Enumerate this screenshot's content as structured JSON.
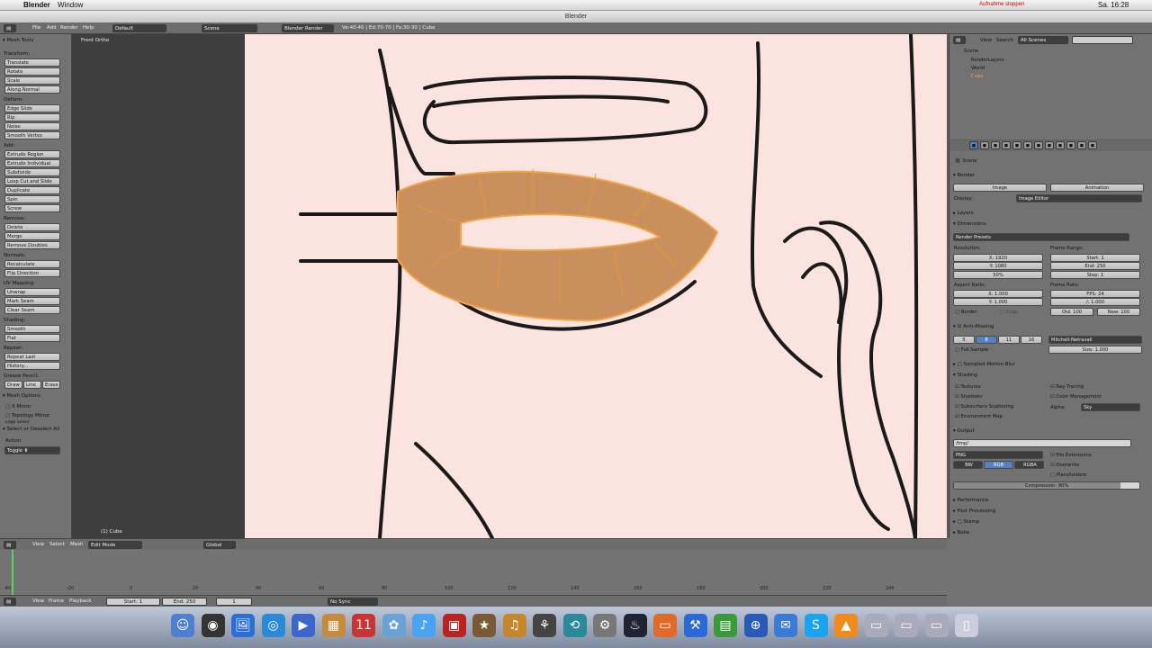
{
  "mac": {
    "app_name": "Blender",
    "window_menu": "Window",
    "status_text": "Aufnahme stoppen",
    "clock": "Sa. 16:28"
  },
  "window_title": "Blender",
  "info_header": {
    "menus": [
      "File",
      "Add",
      "Render",
      "Help"
    ],
    "layout": "Default",
    "scene": "Scene",
    "engine": "Blender Render",
    "stats": "Ve:40-40 | Ed:70-70 | Fa:30-30 | Cube"
  },
  "tool_shelf": {
    "title": "Mesh Tools",
    "sections": [
      {
        "label": "Transform:",
        "buttons": [
          "Translate",
          "Rotate",
          "Scale",
          "Along Normal"
        ]
      },
      {
        "label": "Deform:",
        "buttons": [
          "Edge Slide",
          "Rip",
          "Noise",
          "Smooth Vertex"
        ]
      },
      {
        "label": "Add:",
        "buttons": [
          "Extrude Region",
          "Extrude Individual",
          "Subdivide",
          "Loop Cut and Slide",
          "Duplicate",
          "Spin",
          "Screw"
        ]
      },
      {
        "label": "Remove:",
        "buttons": [
          "Delete",
          "Merge",
          "Remove Doubles"
        ]
      },
      {
        "label": "Normals:",
        "buttons": [
          "Recalculate",
          "Flip Direction"
        ]
      },
      {
        "label": "UV Mapping:",
        "buttons": [
          "Unwrap",
          "Mark Seam",
          "Clear Seam"
        ]
      },
      {
        "label": "Shading:",
        "buttons": [
          "Smooth",
          "Flat"
        ]
      },
      {
        "label": "Repeat:",
        "buttons": [
          "Repeat Last",
          "History..."
        ]
      }
    ],
    "grease_pencil": {
      "label": "Grease Pencil:",
      "buttons": [
        "Draw",
        "Line",
        "Erase"
      ]
    },
    "mesh_options": {
      "title": "Mesh Options",
      "x_mirror": "X Mirror",
      "topology_mirror": "Topology Mirror",
      "edge_select": "Edge Select"
    },
    "operator": {
      "title": "Select or Deselect All",
      "action_label": "Action",
      "action_value": "Toggle"
    }
  },
  "viewport": {
    "view_label": "Front Ortho",
    "object_label": "(1) Cube"
  },
  "outliner": {
    "menus": [
      "View",
      "Search"
    ],
    "filter": "All Scenes",
    "items": [
      "Scene",
      "RenderLayers",
      "World",
      "Cube"
    ]
  },
  "properties": {
    "scene_label": "Scene",
    "render_panel": {
      "title": "Render",
      "image_button": "Image",
      "animation_button": "Animation",
      "display_label": "Display:",
      "display_value": "Image Editor"
    },
    "layers_title": "Layers",
    "dimensions": {
      "title": "Dimensions",
      "presets": "Render Presets",
      "resolution_label": "Resolution:",
      "res_x": "X: 1920",
      "res_y": "Y: 1080",
      "res_pct": "50%",
      "frame_range_label": "Frame Range:",
      "start": "Start: 1",
      "end": "End: 250",
      "step": "Step: 1",
      "aspect_label": "Aspect Ratio:",
      "aspect_x": "X: 1.000",
      "aspect_y": "Y: 1.000",
      "frame_rate_label": "Frame Rate:",
      "fps": "FPS: 24",
      "fps_base": "/: 1.000",
      "border": "Border",
      "crop": "Crop",
      "old": "Old: 100",
      "new": "New: 100"
    },
    "anti_aliasing": {
      "title": "Anti-Aliasing",
      "samples": [
        "5",
        "8",
        "11",
        "16"
      ],
      "selected": "8",
      "filter": "Mitchell-Netravali",
      "full_sample": "Full Sample",
      "size": "Size: 1.000"
    },
    "motion_blur": "Sampled Motion Blur",
    "shading": {
      "title": "Shading",
      "left": [
        "Textures",
        "Shadows",
        "Subsurface Scattering",
        "Environment Map"
      ],
      "right": [
        "Ray Tracing",
        "Color Management"
      ],
      "alpha_label": "Alpha:",
      "alpha_value": "Sky"
    },
    "output": {
      "title": "Output",
      "path": "/tmp/",
      "format": "PNG",
      "color_modes": [
        "BW",
        "RGB",
        "RGBA"
      ],
      "selected_mode": "RGB",
      "file_ext": "File Extensions",
      "overwrite": "Overwrite",
      "placeholders": "Placeholders",
      "compression": "Compression: 90%",
      "compression_value": 0.9
    },
    "collapsed": [
      "Performance",
      "Post Processing",
      "Stamp",
      "Bake"
    ]
  },
  "viewport_header": {
    "menus": [
      "View",
      "Select",
      "Mesh"
    ],
    "mode": "Edit Mode",
    "orientation": "Global"
  },
  "timeline": {
    "ticks": [
      "-40",
      "-20",
      "0",
      "20",
      "40",
      "60",
      "80",
      "100",
      "120",
      "140",
      "160",
      "180",
      "200",
      "220",
      "240"
    ],
    "menus": [
      "View",
      "Frame",
      "Playback"
    ],
    "start": "Start: 1",
    "end": "End: 250",
    "current": "1",
    "sync": "No Sync"
  },
  "dock_icons": [
    "finder-icon",
    "dashboard-icon",
    "preview-icon",
    "safari-icon",
    "facetime-icon",
    "contacts-icon",
    "ical-icon",
    "iphoto-icon",
    "itunes-icon",
    "photo-booth-icon",
    "imovie-icon",
    "garageband-icon",
    "guitar-icon",
    "timemachine-icon",
    "system-prefs-icon",
    "steam-icon",
    "app-icon",
    "xcode-icon",
    "chart-icon",
    "network-icon",
    "mail-icon",
    "skype-icon",
    "vlc-icon",
    "folder-icon",
    "documents-icon",
    "downloads-icon",
    "trash-icon"
  ]
}
